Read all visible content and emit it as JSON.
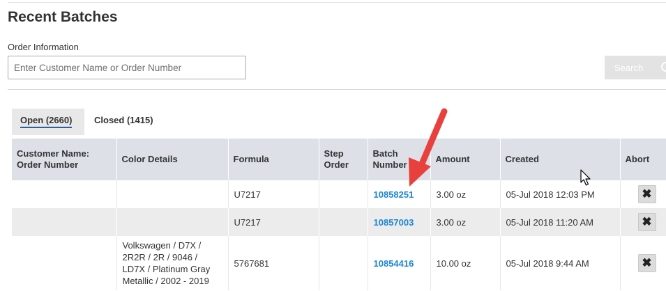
{
  "page": {
    "title": "Recent Batches"
  },
  "search": {
    "label": "Order Information",
    "placeholder": "Enter Customer Name or Order Number",
    "button_label": "Search"
  },
  "tabs": [
    {
      "label": "Open (2660)",
      "active": true
    },
    {
      "label": "Closed (1415)",
      "active": false
    }
  ],
  "table": {
    "headers": [
      "Customer Name: Order Number",
      "Color Details",
      "Formula",
      "Step Order",
      "Batch Number",
      "Amount",
      "Created",
      "Abort"
    ],
    "rows": [
      {
        "customer": "",
        "color_details": "",
        "formula": "U7217",
        "step_order": "",
        "batch_number": "10858251",
        "amount": "3.00 oz",
        "created": "05-Jul 2018 12:03 PM"
      },
      {
        "customer": "",
        "color_details": "",
        "formula": "U7217",
        "step_order": "",
        "batch_number": "10857003",
        "amount": "3.00 oz",
        "created": "05-Jul 2018 11:20 AM"
      },
      {
        "customer": "",
        "color_details": "Volkswagen / D7X / 2R2R / 2R / 9046 / LD7X / Platinum Gray Metallic / 2002 - 2019",
        "formula": "5767681",
        "step_order": "",
        "batch_number": "10854416",
        "amount": "10.00 oz",
        "created": "05-Jul 2018 9:44 AM"
      }
    ],
    "abort_symbol": "✖"
  },
  "colors": {
    "link": "#1f86d1",
    "annotation_arrow": "#e8413d",
    "tab_underline": "#2e5fa3"
  }
}
